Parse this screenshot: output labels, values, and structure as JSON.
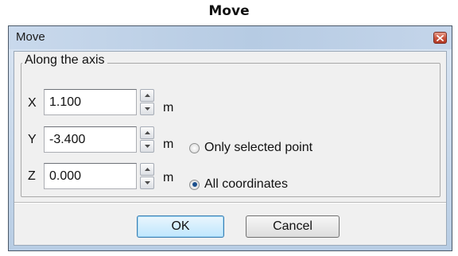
{
  "caption": "Move",
  "window": {
    "title": "Move",
    "close_icon": "close-icon"
  },
  "group": {
    "legend": "Along the axis"
  },
  "axes": [
    {
      "label": "X",
      "value": "1.100",
      "unit": "m"
    },
    {
      "label": "Y",
      "value": "-3.400",
      "unit": "m"
    },
    {
      "label": "Z",
      "value": "0.000",
      "unit": "m"
    }
  ],
  "radios": [
    {
      "label": "Only selected point",
      "checked": false
    },
    {
      "label": "All coordinates",
      "checked": true
    }
  ],
  "buttons": {
    "ok": "OK",
    "cancel": "Cancel"
  },
  "colors": {
    "title_gradient": "#b6cbe3",
    "close_button": "#c7503b",
    "default_button_border": "#3c7fb1"
  }
}
